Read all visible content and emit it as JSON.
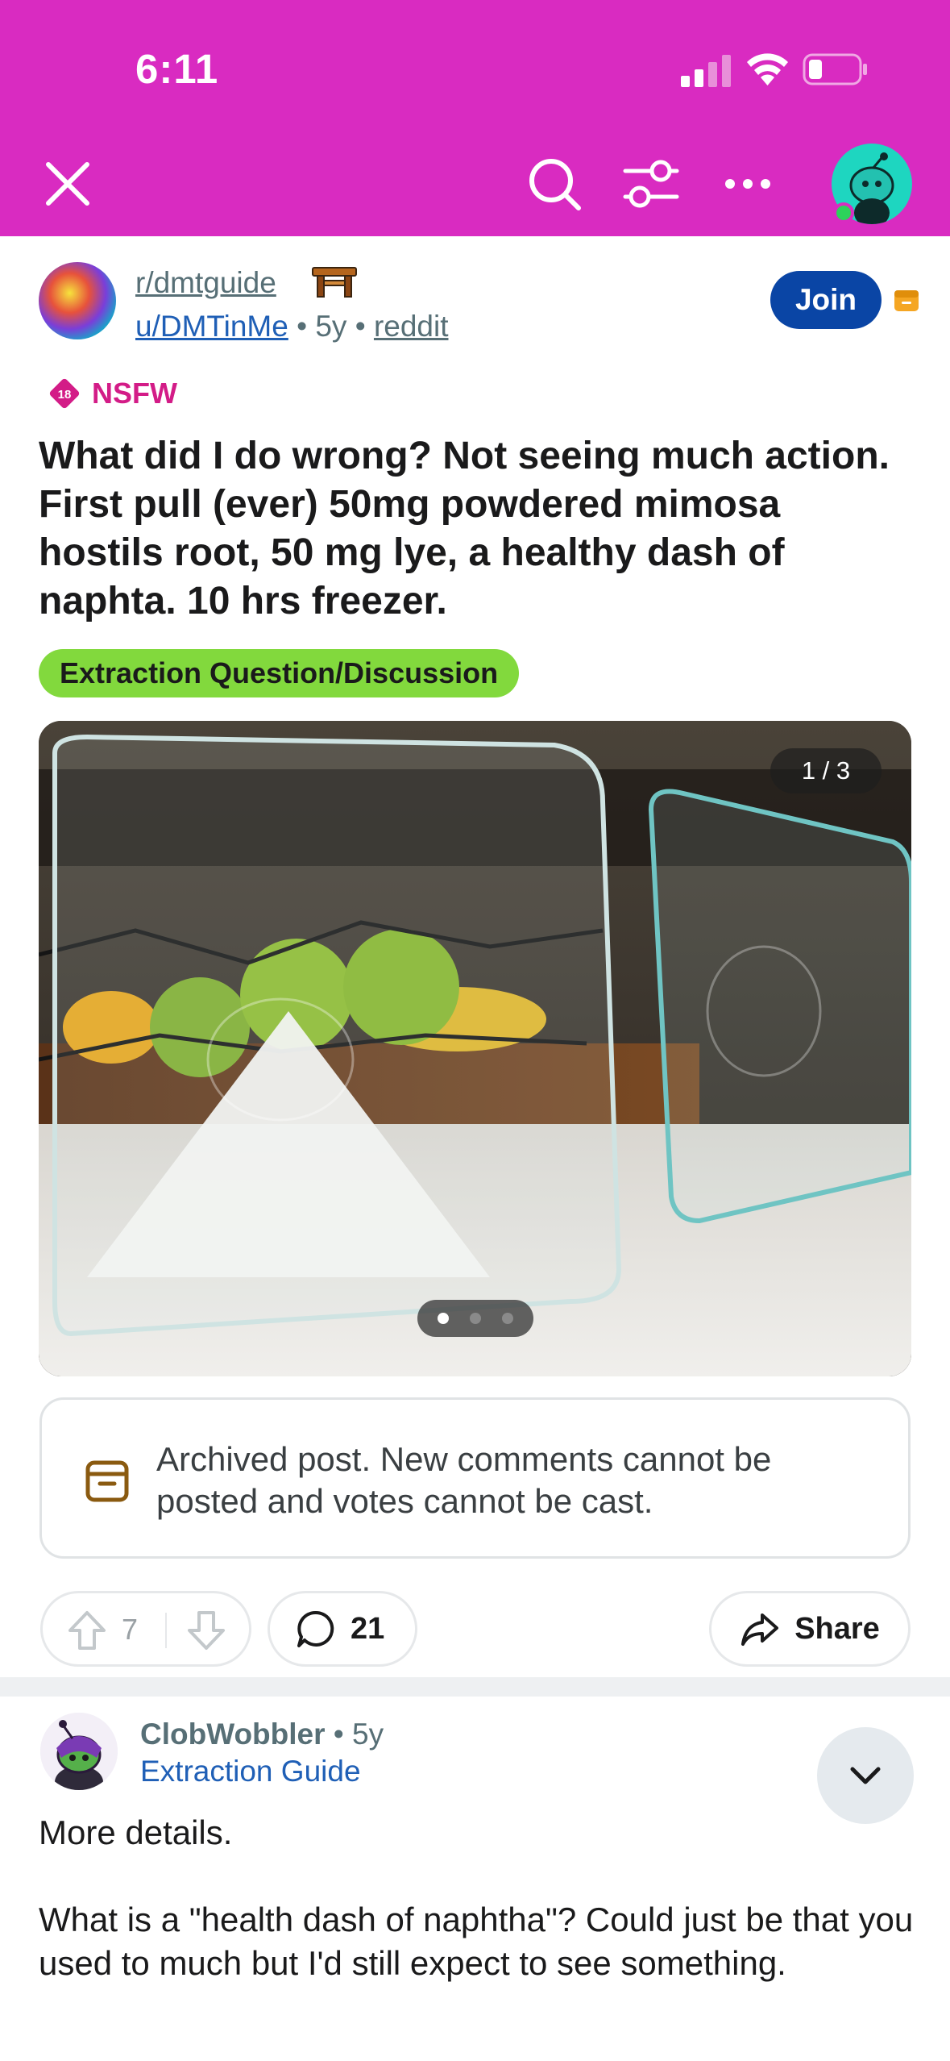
{
  "status_bar": {
    "time": "6:11"
  },
  "colors": {
    "header": "#d92bc1",
    "join": "#0a45a5",
    "flair": "#82d93d",
    "nsfw": "#d31c87",
    "link": "#1f5fb6"
  },
  "header_icons": [
    "close-icon",
    "search-icon",
    "filter-icon",
    "more-icon",
    "profile-avatar"
  ],
  "post": {
    "subreddit": "r/dmtguide",
    "author": "u/DMTinMe",
    "age": "5y",
    "source": "reddit",
    "join_label": "Join",
    "nsfw_badge": "18",
    "nsfw_label": "NSFW",
    "title": "What did I do wrong? Not seeing much action. First pull (ever) 50mg powdered mimosa hostils root, 50 mg lye, a healthy dash of naphta. 10 hrs freezer.",
    "flair": "Extraction Question/Discussion",
    "image_counter": "1 / 3",
    "image_count": 3,
    "active_image": 1,
    "archived_notice": "Archived post. New comments cannot be posted and votes cannot be cast.",
    "upvotes": "7",
    "comments": "21",
    "share_label": "Share"
  },
  "comment": {
    "author": "ClobWobbler",
    "age": "5y",
    "flair": "Extraction Guide",
    "body": "More details.\n\nWhat is a \"health dash of naphtha\"? Could just be that you used to much but I'd still expect to see something."
  }
}
